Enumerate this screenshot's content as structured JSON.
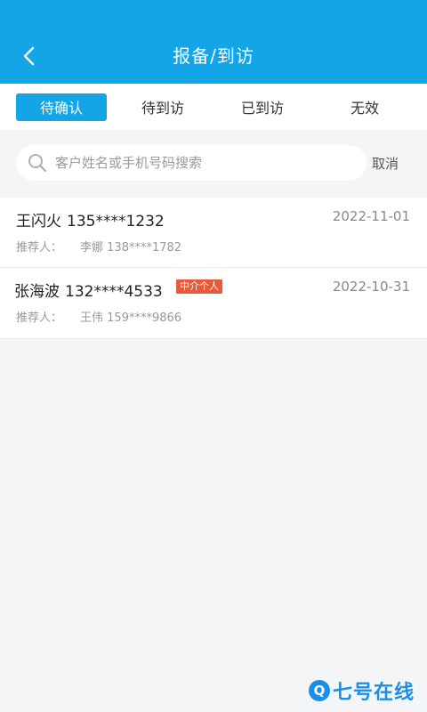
{
  "header": {
    "title": "报备/到访",
    "back_icon": "chevron-left-icon"
  },
  "tabs": [
    {
      "label": "待确认",
      "active": true
    },
    {
      "label": "待到访",
      "active": false
    },
    {
      "label": "已到访",
      "active": false
    },
    {
      "label": "无效",
      "active": false
    }
  ],
  "search": {
    "placeholder": "客户姓名或手机号码搜索",
    "value": "",
    "cancel_label": "取消",
    "icon": "search-icon"
  },
  "records": [
    {
      "name": "王闪火",
      "phone": "135****1232",
      "tag": "",
      "date": "2022-11-01",
      "referrer_label": "推荐人：",
      "referrer": "李娜 138****1782"
    },
    {
      "name": "张海波",
      "phone": "132****4533",
      "tag": "中介个人",
      "date": "2022-10-31",
      "referrer_label": "推荐人：",
      "referrer": "王伟 159****9866"
    }
  ],
  "watermark": {
    "icon_letter": "Q",
    "text": "七号在线"
  },
  "colors": {
    "primary": "#13a5e6",
    "tag": "#e85a3c",
    "background": "#f4f5f7"
  }
}
